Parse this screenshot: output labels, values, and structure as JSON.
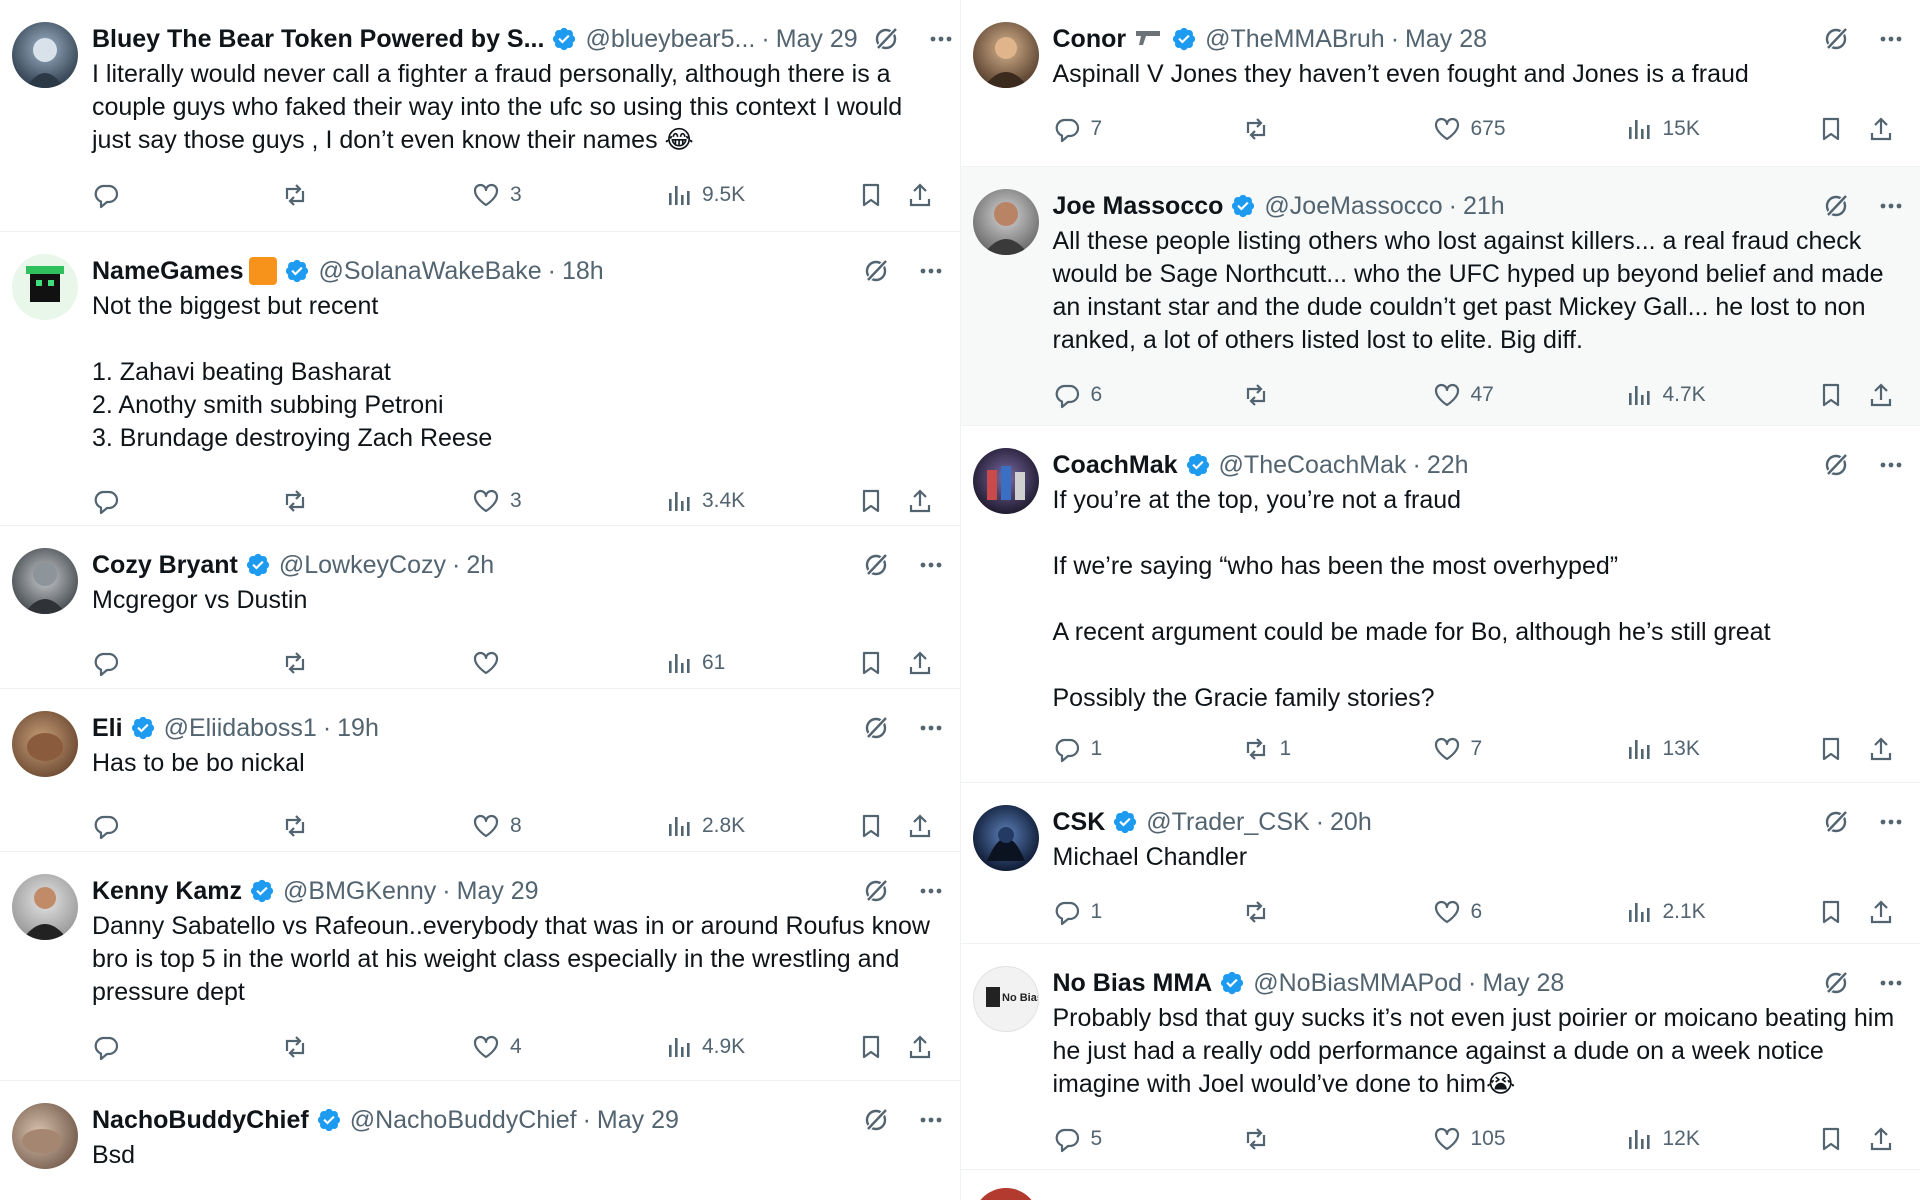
{
  "left_column": [
    {
      "name": "Bluey The Bear Token Powered by S...",
      "handle": "@blueybear5...",
      "time": "May 29",
      "text": "I literally would never call a fighter a fraud personally, although there is a couple guys who faked their way into the ufc so using this context I would just say those guys , I don’t even know their names 😂",
      "replies": "",
      "retweets": "",
      "likes": "3",
      "views": "9.5K"
    },
    {
      "name": "NameGames",
      "handle": "@SolanaWakeBake",
      "time": "18h",
      "text": "Not the biggest but recent\n\n1. Zahavi beating Basharat\n2. Anothy smith subbing Petroni\n3. Brundage destroying Zach Reese",
      "replies": "",
      "retweets": "",
      "likes": "3",
      "views": "3.4K"
    },
    {
      "name": "Cozy Bryant",
      "handle": "@LowkeyCozy",
      "time": "2h",
      "text": "Mcgregor vs Dustin",
      "replies": "",
      "retweets": "",
      "likes": "",
      "views": "61"
    },
    {
      "name": "Eli",
      "handle": "@Eliidaboss1",
      "time": "19h",
      "text": "Has to be bo nickal",
      "replies": "",
      "retweets": "",
      "likes": "8",
      "views": "2.8K"
    },
    {
      "name": "Kenny Kamz",
      "handle": "@BMGKenny",
      "time": "May 29",
      "text": "Danny Sabatello vs Rafeoun..everybody that was in or around Roufus know bro is top 5 in the world at his weight class especially in the wrestling and pressure dept",
      "replies": "",
      "retweets": "",
      "likes": "4",
      "views": "4.9K"
    },
    {
      "name": "NachoBuddyChief",
      "handle": "@NachoBuddyChief",
      "time": "May 29",
      "text": "Bsd",
      "replies": "",
      "retweets": "",
      "likes": "",
      "views": ""
    }
  ],
  "right_column": [
    {
      "name": "Conor",
      "handle": "@TheMMABruh",
      "time": "May 28",
      "text": "Aspinall V Jones they haven’t even fought and Jones is a fraud",
      "replies": "7",
      "retweets": "",
      "likes": "675",
      "views": "15K"
    },
    {
      "name": "Joe Massocco",
      "handle": "@JoeMassocco",
      "time": "21h",
      "text": "All these people listing others who lost against killers... a real fraud check would be Sage Northcutt... who the UFC hyped up beyond belief and made an instant star and the dude couldn’t get past Mickey Gall... he lost to non ranked, a lot of others listed lost to elite. Big diff.",
      "replies": "6",
      "retweets": "",
      "likes": "47",
      "views": "4.7K"
    },
    {
      "name": "CoachMak",
      "handle": "@TheCoachMak",
      "time": "22h",
      "text": "If you’re at the top, you’re not a fraud\n\nIf we’re saying “who has been the most overhyped”\n\nA recent argument could be made for Bo, although he’s still great\n\nPossibly the Gracie family stories?",
      "replies": "1",
      "retweets": "1",
      "likes": "7",
      "views": "13K"
    },
    {
      "name": "CSK",
      "handle": "@Trader_CSK",
      "time": "20h",
      "text": "Michael Chandler",
      "replies": "1",
      "retweets": "",
      "likes": "6",
      "views": "2.1K"
    },
    {
      "name": "No Bias MMA",
      "handle": "@NoBiasMMAPod",
      "time": "May 28",
      "text": "Probably bsd that guy sucks it’s not even just poirier or moicano beating him he just had a really odd performance against a dude on a week notice imagine with Joel would’ve done to him😭",
      "replies": "5",
      "retweets": "",
      "likes": "105",
      "views": "12K"
    }
  ],
  "avatar_text": {
    "no_bias": "No Bias"
  },
  "colors": {
    "verified": "#1d9bf0",
    "muted": "#536471",
    "text": "#0f1419",
    "divider": "#eff3f4",
    "hover_bg": "#f7f9f9",
    "badge": "#f7931a"
  }
}
